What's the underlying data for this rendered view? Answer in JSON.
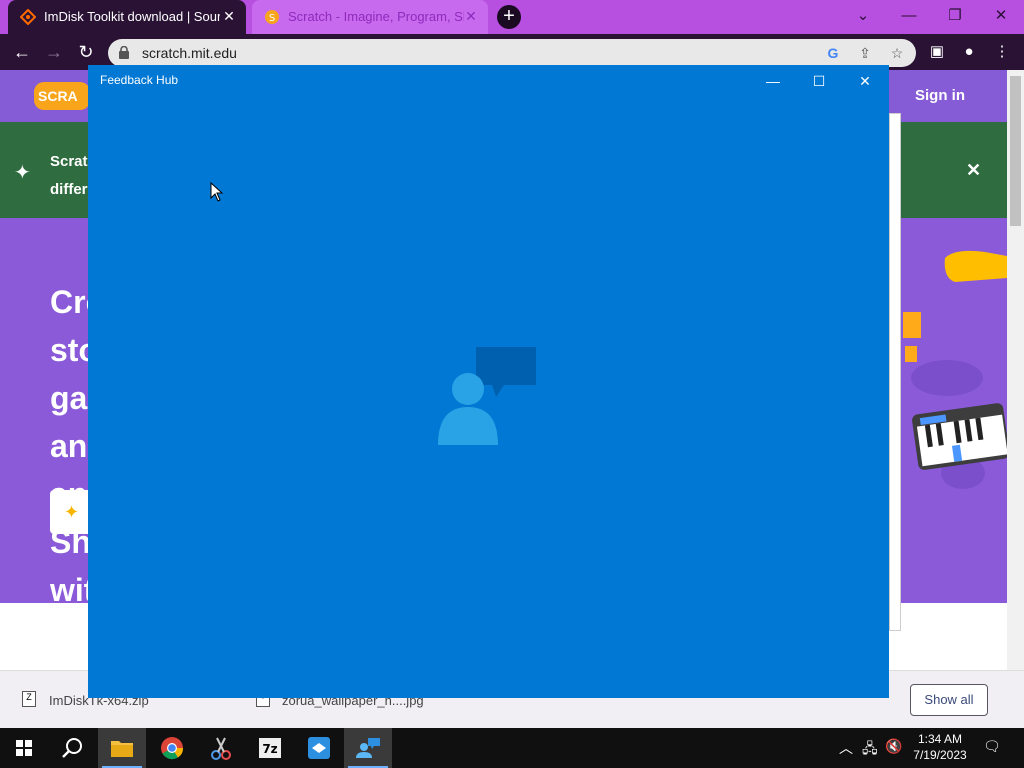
{
  "browser": {
    "tabs": [
      {
        "title": "ImDisk Toolkit download | SourceForge",
        "active": true
      },
      {
        "title": "Scratch - Imagine, Program, Share",
        "active": false
      }
    ],
    "url": "scratch.mit.edu"
  },
  "scratch_page": {
    "sign_in": "Sign in",
    "banner_text": "Scratch different",
    "hero_heading": "Create stories, games, and animations Share with others around the world"
  },
  "downloads": {
    "items": [
      {
        "name": "ImDiskTk-x64.zip"
      },
      {
        "name": "zorua_wallpaper_h....jpg"
      }
    ],
    "show_all": "Show all"
  },
  "feedback_hub": {
    "title": "Feedback Hub"
  },
  "taskbar": {
    "time": "1:34 AM",
    "date": "7/19/2023",
    "apps": [
      "start",
      "search",
      "file-explorer",
      "chrome",
      "snipping-tool",
      "7zip",
      "unknown-app",
      "feedback-hub"
    ]
  },
  "colors": {
    "feedback_hub_blue": "#0078d4",
    "tab_bar": "#b74fe0",
    "toolbar": "#2a1235",
    "scratch_purple": "#855cd6"
  }
}
